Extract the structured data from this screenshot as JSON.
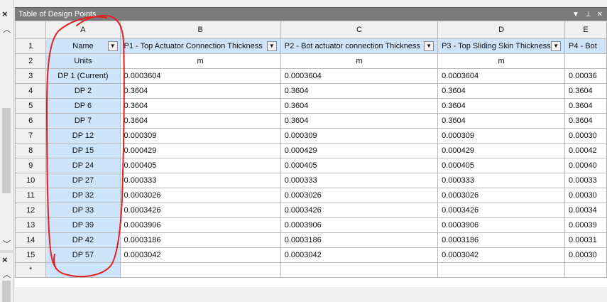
{
  "panel": {
    "title": "Table of Design Points",
    "close_glyph": "X",
    "pin_glyph": "▾  ᚘ  X"
  },
  "columns": [
    {
      "letter": "",
      "header": "",
      "width": 46
    },
    {
      "letter": "A",
      "header": "Name",
      "width": 107
    },
    {
      "letter": "B",
      "header": "P1 - Top Actuator Connection Thickness",
      "width": 227
    },
    {
      "letter": "C",
      "header": "P2 - Bot actuator connection Thickness",
      "width": 222
    },
    {
      "letter": "D",
      "header": "P3 - Top Sliding Skin Thickness",
      "width": 179
    },
    {
      "letter": "E",
      "header": "P4 - Bot",
      "width": 60
    }
  ],
  "units_row": {
    "label": "Units",
    "b": "m",
    "c": "m",
    "d": "m",
    "e": ""
  },
  "rows": [
    {
      "num": "3",
      "name": "DP 1 (Current)",
      "b": "0.0003604",
      "c": "0.0003604",
      "d": "0.0003604",
      "e": "0.00036"
    },
    {
      "num": "4",
      "name": "DP 2",
      "b": "0.3604",
      "c": "0.3604",
      "d": "0.3604",
      "e": "0.3604"
    },
    {
      "num": "5",
      "name": "DP 6",
      "b": "0.3604",
      "c": "0.3604",
      "d": "0.3604",
      "e": "0.3604"
    },
    {
      "num": "6",
      "name": "DP 7",
      "b": "0.3604",
      "c": "0.3604",
      "d": "0.3604",
      "e": "0.3604"
    },
    {
      "num": "7",
      "name": "DP 12",
      "b": "0.000309",
      "c": "0.000309",
      "d": "0.000309",
      "e": "0.00030"
    },
    {
      "num": "8",
      "name": "DP 15",
      "b": "0.000429",
      "c": "0.000429",
      "d": "0.000429",
      "e": "0.00042"
    },
    {
      "num": "9",
      "name": "DP 24",
      "b": "0.000405",
      "c": "0.000405",
      "d": "0.000405",
      "e": "0.00040"
    },
    {
      "num": "10",
      "name": "DP 27",
      "b": "0.000333",
      "c": "0.000333",
      "d": "0.000333",
      "e": "0.00033"
    },
    {
      "num": "11",
      "name": "DP 32",
      "b": "0.0003026",
      "c": "0.0003026",
      "d": "0.0003026",
      "e": "0.00030"
    },
    {
      "num": "12",
      "name": "DP 33",
      "b": "0.0003426",
      "c": "0.0003426",
      "d": "0.0003426",
      "e": "0.00034"
    },
    {
      "num": "13",
      "name": "DP 39",
      "b": "0.0003906",
      "c": "0.0003906",
      "d": "0.0003906",
      "e": "0.00039"
    },
    {
      "num": "14",
      "name": "DP 42",
      "b": "0.0003186",
      "c": "0.0003186",
      "d": "0.0003186",
      "e": "0.00031"
    },
    {
      "num": "15",
      "name": "DP 57",
      "b": "0.0003042",
      "c": "0.0003042",
      "d": "0.0003042",
      "e": "0.00030"
    }
  ],
  "new_row_marker": "*",
  "row_labels": {
    "header_row": "1",
    "units_row": "2"
  },
  "icons": {
    "dropdown": "chevron-down-icon",
    "close": "close-icon",
    "pin": "pin-icon",
    "scroll_up": "chevron-up-icon",
    "scroll_down": "chevron-down-icon"
  },
  "colors": {
    "selection": "#cde4fb",
    "titlebar": "#7b7b7b",
    "annotation": "#e02020"
  }
}
